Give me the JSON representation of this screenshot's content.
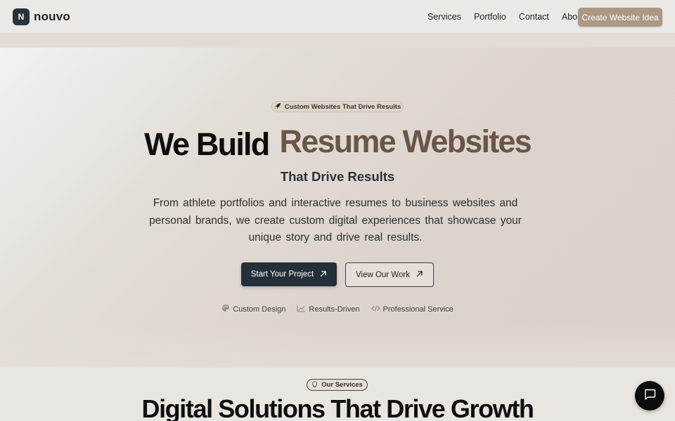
{
  "header": {
    "logo_letter": "N",
    "logo_name": "nouvo",
    "nav": [
      "Services",
      "Portfolio",
      "Contact",
      "About"
    ],
    "cta_label": "Create Website Idea"
  },
  "hero": {
    "badge_icon": "rocket-icon",
    "badge_text": "Custom Websites That Drive Results",
    "title_part1": "We Build",
    "title_part2": "Resume Websites",
    "subtitle": "That Drive Results",
    "description": "From athlete portfolios and interactive resumes to business websites and personal brands, we create custom digital experiences that showcase your unique story and drive real results.",
    "primary_button": "Start Your Project",
    "secondary_button": "View Our Work",
    "features": [
      {
        "icon": "palette-icon",
        "label": "Custom Design"
      },
      {
        "icon": "chart-trend-icon",
        "label": "Results-Driven"
      },
      {
        "icon": "code-icon",
        "label": "Professional Service"
      }
    ]
  },
  "services": {
    "badge_icon": "lightbulb-icon",
    "badge_text": "Our Services",
    "title": "Digital Solutions That Drive Growth"
  },
  "chat": {
    "icon": "chat-icon"
  },
  "colors": {
    "primary_dark": "#232f39",
    "accent_brown": "#6a5646",
    "cta_tan": "#ad9785"
  }
}
